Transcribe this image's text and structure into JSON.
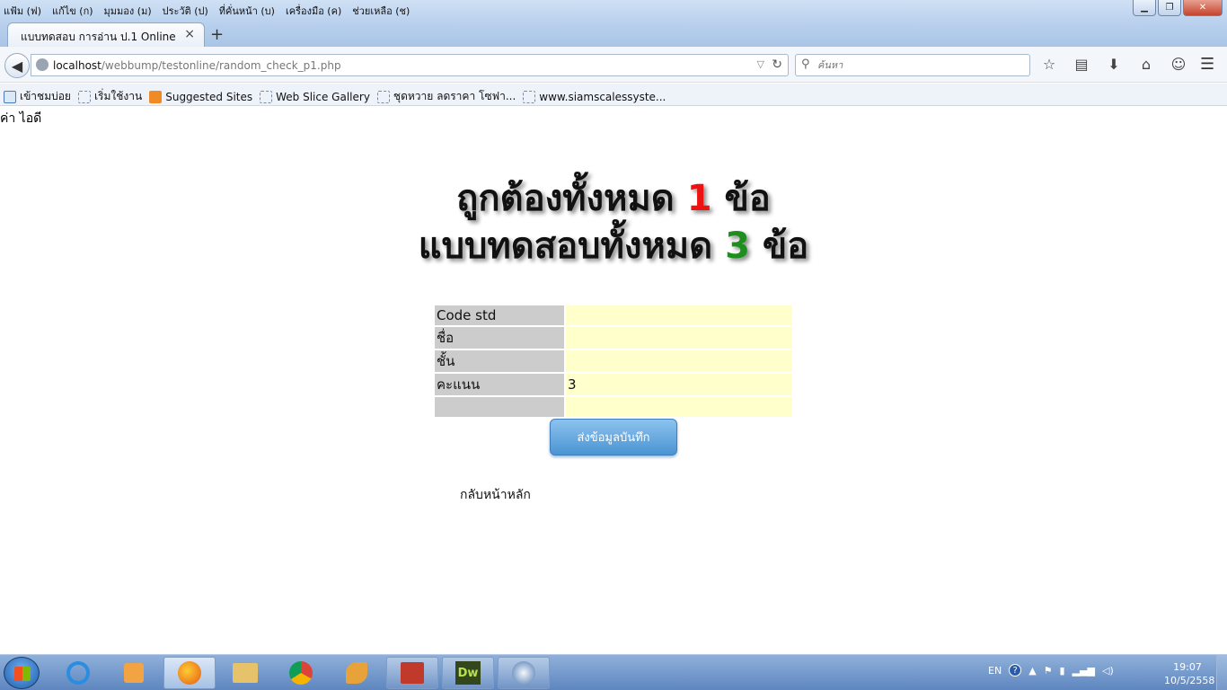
{
  "menubar": {
    "items": [
      "แฟ้ม (ฟ)",
      "แก้ไข (ก)",
      "มุมมอง (ม)",
      "ประวัติ (ป)",
      "ที่คั่นหน้า (บ)",
      "เครื่องมือ (ค)",
      "ช่วยเหลือ (ช)"
    ]
  },
  "tab": {
    "title": "แบบทดสอบ การอ่าน ป.1 Online"
  },
  "urlbar": {
    "host": "localhost",
    "path": "/webbump/testonline/random_check_p1.php"
  },
  "search": {
    "placeholder": "ค้นหา"
  },
  "bookmarks": [
    "เข้าชมบ่อย",
    "เริ่มใช้งาน",
    "Suggested Sites",
    "Web Slice Gallery",
    "ชุดหวาย ลดราคา โซฟา...",
    "www.siamscalessyste..."
  ],
  "page": {
    "id_label": "ค่า ไอดี",
    "line1_prefix": "ถูกต้องทั้งหมด ",
    "line1_number": "1",
    "line1_suffix": " ข้อ",
    "line2_prefix": "แบบทดสอบทั้งหมด ",
    "line2_number": "3",
    "line2_suffix": " ข้อ",
    "table": [
      {
        "label": "Code std",
        "value": ""
      },
      {
        "label": "ชื่อ",
        "value": ""
      },
      {
        "label": "ชั้น",
        "value": ""
      },
      {
        "label": "คะแนน",
        "value": "3"
      },
      {
        "label": "",
        "value": ""
      }
    ],
    "submit_label": "ส่งข้อมูลบันทึก",
    "back_link": "กลับหน้าหลัก"
  },
  "taskbar": {
    "lang": "EN",
    "time": "19:07",
    "date": "10/5/2558"
  },
  "colors": {
    "correct_number": "#ee1111",
    "total_number": "#1e8e1e",
    "table_label_bg": "#cccccc",
    "table_value_bg": "#ffffcc"
  }
}
